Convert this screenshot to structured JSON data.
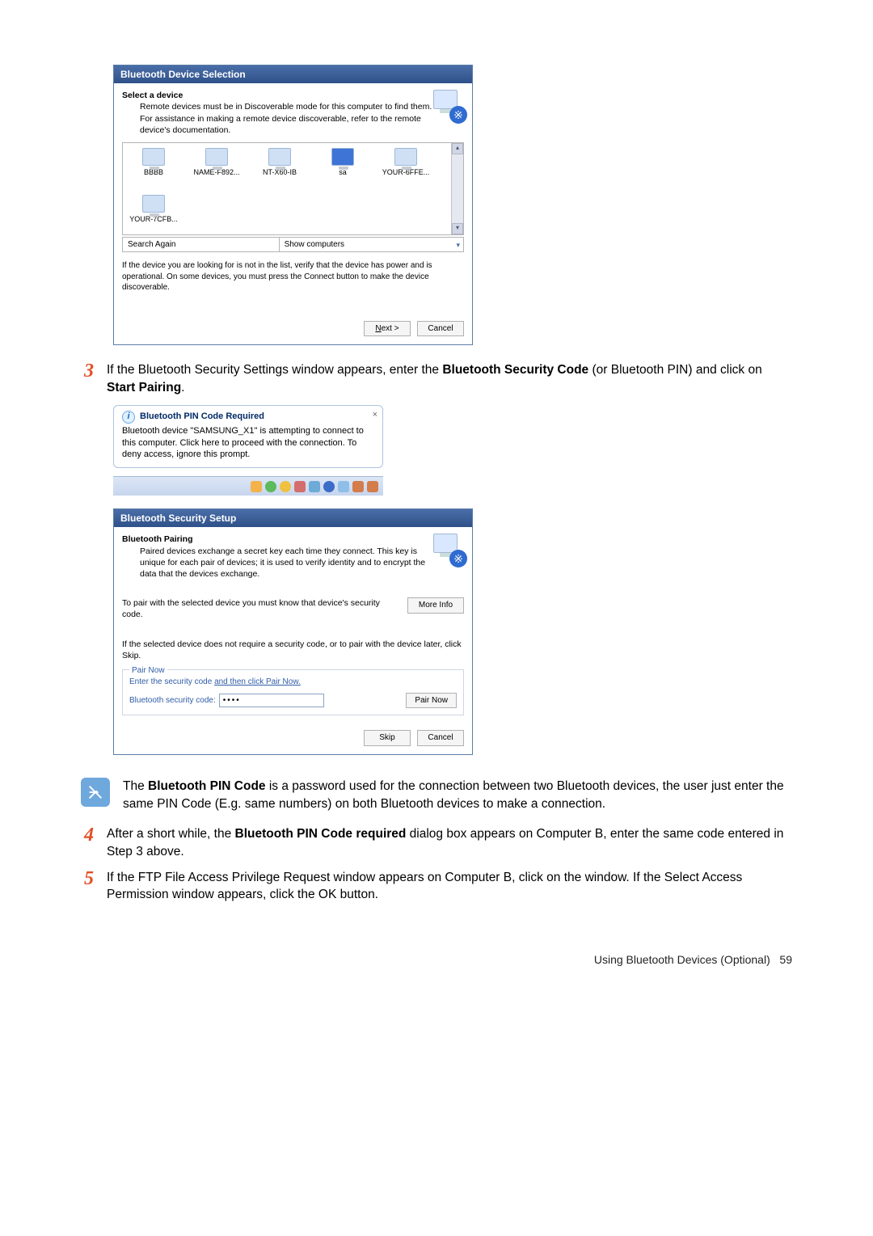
{
  "dialog1": {
    "title": "Bluetooth Device Selection",
    "heading": "Select a device",
    "subtext": "Remote devices must be in Discoverable mode for this computer to find them. For assistance in making a remote device discoverable, refer to the remote device's documentation.",
    "devices": [
      "BBBB",
      "NAME-F892...",
      "NT-X60-IB",
      "sa",
      "YOUR-6FFE...",
      "YOUR-7CFB..."
    ],
    "search_label": "Search Again",
    "filter_label": "Show computers",
    "help": "If the device you are looking for is not in the list, verify that the device has power and is operational. On some devices, you must press the Connect button to make the device discoverable.",
    "next": "Next >",
    "cancel": "Cancel"
  },
  "step3": {
    "text_a": "If the Bluetooth Security Settings window appears, enter the ",
    "bold_a": "Bluetooth Security Code",
    "text_b": " (or Bluetooth PIN) and click on ",
    "bold_b": "Start Pairing",
    "text_c": "."
  },
  "tooltip": {
    "title": "Bluetooth PIN Code Required",
    "line": "Bluetooth device \"SAMSUNG_X1\" is attempting to connect to this computer.  Click here to proceed with the connection. To deny access, ignore this prompt."
  },
  "dialog2": {
    "title": "Bluetooth Security Setup",
    "heading": "Bluetooth Pairing",
    "subtext": "Paired devices exchange a secret key each time they connect. This key is unique for each pair of devices; it is used to verify identity and to encrypt the data that the devices exchange.",
    "pair_text": "To pair with the selected device you must know that device's security code.",
    "moreinfo": "More Info",
    "skip_text": "If the selected device does not require a security code, or to pair with the device later, click Skip.",
    "legend": "Pair Now",
    "enter_label": "Enter the security code and then click Pair Now.",
    "code_label": "Bluetooth security code:",
    "code_value": "••••",
    "pairnow_btn": "Pair Now",
    "skip": "Skip",
    "cancel": "Cancel"
  },
  "note": {
    "text_a": "The ",
    "bold": "Bluetooth PIN Code",
    "text_b": " is a password used for the connection between two Bluetooth devices, the user just enter the same PIN Code (E.g. same numbers) on both Bluetooth devices to make a connection."
  },
  "step4": {
    "text_a": "After a short while, the ",
    "bold": "Bluetooth PIN Code required",
    "text_b": " dialog box appears on Computer B, enter the same code entered in Step 3 above."
  },
  "step5": {
    "text": "If the FTP File Access Privilege Request window appears on Computer B, click on the window. If the Select Access Permission window appears, click the OK button."
  },
  "footer": {
    "label": "Using Bluetooth Devices (Optional)",
    "page": "59"
  }
}
